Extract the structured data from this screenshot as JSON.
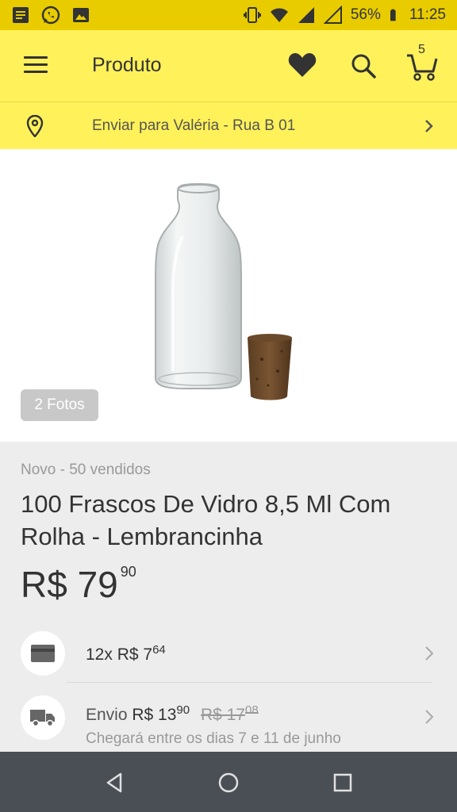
{
  "status_bar": {
    "battery": "56%",
    "time": "11:25",
    "icons": [
      "notes-icon",
      "whatsapp-icon",
      "gallery-icon",
      "vibrate-icon",
      "wifi-icon",
      "signal-icon",
      "signal-empty-icon",
      "battery-icon"
    ]
  },
  "appbar": {
    "title": "Produto",
    "cart_count": "5"
  },
  "shipping_bar": {
    "text": "Enviar para Valéria - Rua B 01"
  },
  "gallery": {
    "photos_badge": "2 Fotos"
  },
  "product": {
    "condition": "Novo - 50 vendidos",
    "title": "100 Frascos De Vidro 8,5 Ml Com Rolha - Lembrancinha",
    "price_main": "R$ 79",
    "price_cents": "90"
  },
  "installments": {
    "prefix": "12x R$ 7",
    "cents": "64"
  },
  "shipping": {
    "label": "Envio",
    "price_main": "R$ 13",
    "price_cents": "90",
    "old_price_main": "R$ 17",
    "old_price_cents": "08",
    "delivery": "Chegará entre os dias 7 e 11 de junho"
  },
  "colors": {
    "brand_yellow": "#fff159",
    "status_yellow": "#e8cc00",
    "navbar": "#4a4f56"
  }
}
